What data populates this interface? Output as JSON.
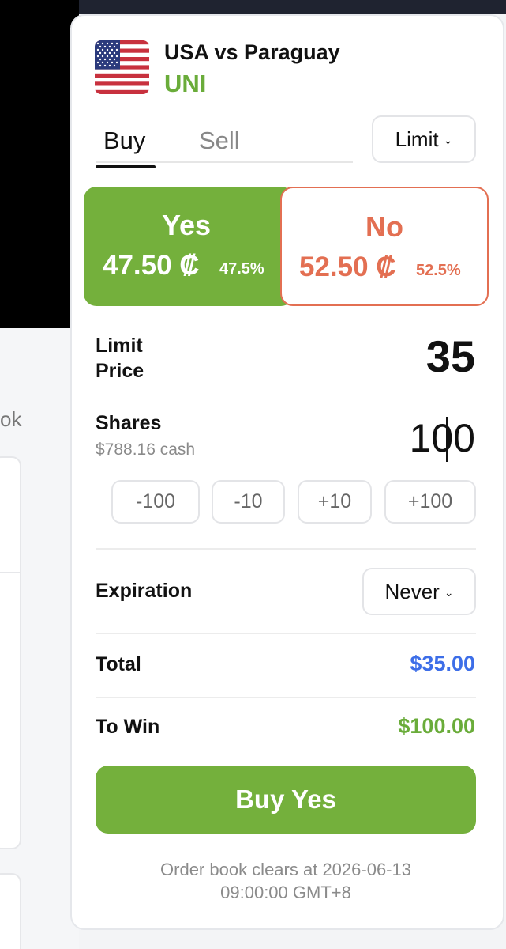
{
  "background": {
    "partial_text": "ok"
  },
  "market": {
    "title": "USA vs Paraguay",
    "outcome": "UNI",
    "flag_icon": "us-flag-icon"
  },
  "tabs": {
    "buy": "Buy",
    "sell": "Sell",
    "active": "Buy"
  },
  "order_type": {
    "selected": "Limit"
  },
  "outcomes": {
    "yes": {
      "label": "Yes",
      "price": "47.50 ₡",
      "pct": "47.5%",
      "color": "#74b03c"
    },
    "no": {
      "label": "No",
      "price": "52.50 ₡",
      "pct": "52.5%",
      "color": "#e36f52"
    }
  },
  "limit_price": {
    "label": "Limit Price",
    "value": "35"
  },
  "shares": {
    "label": "Shares",
    "cash": "$788.16 cash",
    "value": "100",
    "steps": [
      "-100",
      "-10",
      "+10",
      "+100"
    ]
  },
  "expiration": {
    "label": "Expiration",
    "selected": "Never"
  },
  "total": {
    "label": "Total",
    "value": "$35.00",
    "color": "#3d6ee8"
  },
  "to_win": {
    "label": "To Win",
    "value": "$100.00",
    "color": "#6aac3a"
  },
  "submit": {
    "label": "Buy Yes"
  },
  "footer": {
    "note_line1": "Order book clears at 2026-06-13",
    "note_line2": "09:00:00 GMT+8"
  }
}
